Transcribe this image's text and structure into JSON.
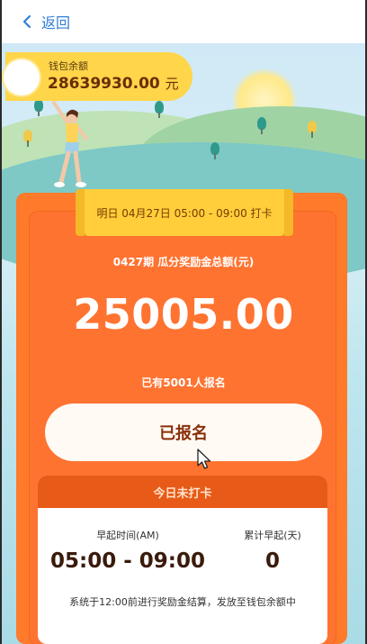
{
  "nav": {
    "back_label": "返回"
  },
  "wallet": {
    "label": "钱包余额",
    "amount": "28639930.00",
    "unit": "元"
  },
  "checkin": {
    "schedule": "明日 04月27日 05:00 - 09:00 打卡",
    "pool_title": "0427期 瓜分奖励金总额(元)",
    "pool_amount": "25005.00",
    "enrolled_text": "已有5001人报名",
    "button_label": "已报名"
  },
  "status": {
    "title": "今日未打卡",
    "wake_time_label": "早起时间(AM)",
    "wake_time_value": "05:00 - 09:00",
    "streak_label": "累计早起(天)",
    "streak_value": "0",
    "note": "系统于12:00前进行奖励金结算，发放至钱包余额中"
  },
  "colors": {
    "accent_blue": "#2f7fd6",
    "card_orange": "#ff7a2a",
    "ribbon_yellow": "#ffce3a",
    "status_header": "#e85a18"
  },
  "icons": {
    "back": "chevron-left-icon",
    "cursor": "mouse-pointer-icon"
  }
}
